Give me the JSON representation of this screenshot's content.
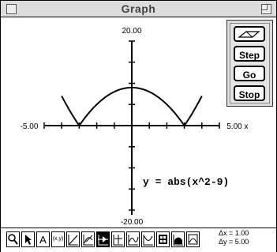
{
  "window": {
    "title": "Graph"
  },
  "graph": {
    "y_max_label": "20.00",
    "y_min_label": "-20.00",
    "x_min_label": "-5.00",
    "x_max_label": "5.00",
    "x_var": "x",
    "equation": "y = abs(x^2-9)",
    "x_range": [
      -5,
      5
    ],
    "y_range": [
      -20,
      20
    ]
  },
  "chart_data": {
    "type": "line",
    "title": "",
    "xlabel": "x",
    "ylabel": "",
    "xlim": [
      -5,
      5
    ],
    "ylim": [
      -20,
      20
    ],
    "grid": false,
    "series": [
      {
        "formula": "y = abs(x^2-9)",
        "x": [
          -4,
          -3.5,
          -3,
          -2,
          -1,
          0,
          1,
          2,
          3,
          3.5,
          4
        ],
        "y": [
          7,
          3.25,
          0,
          5,
          8,
          9,
          8,
          5,
          0,
          3.25,
          7
        ]
      }
    ]
  },
  "controls": {
    "step_label": "Step",
    "go_label": "Go",
    "stop_label": "Stop"
  },
  "toolbar": {
    "items": [
      "zoom-icon",
      "arrow-icon",
      "text-tool-icon",
      "coordinate-icon",
      "line-tool-icon",
      "tangent-icon",
      "trace-icon",
      "intersection-icon",
      "derivative-icon",
      "graph-tool-icon",
      "table-icon",
      "region-icon",
      "graph-image-icon"
    ],
    "xy_label": "(x,y)",
    "dx_label": "Δx = 1.00",
    "dy_label": "Δy = 5.00"
  }
}
